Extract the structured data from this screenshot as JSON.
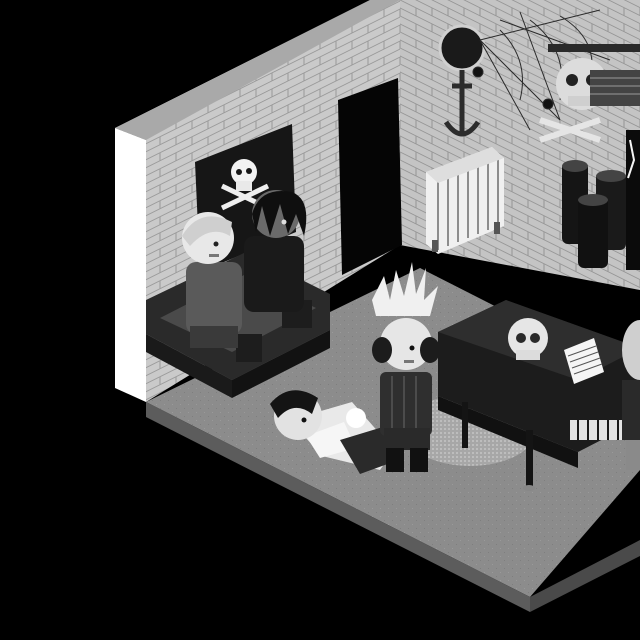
{
  "scene": {
    "style": "isometric pixel-art room, grayscale",
    "palette": {
      "background": "#000000",
      "floor": "#8a8a8a",
      "floor_edge": "#5c5c5c",
      "wall": "#c9c9c9",
      "wall_top": "#a8a8a8",
      "mortar": "#9c9c9c",
      "dark": "#1c1c1c",
      "mid": "#3a3a3a",
      "light": "#e6e6e6",
      "white": "#ffffff"
    },
    "objects": [
      "room-floor",
      "left-brick-wall",
      "right-brick-wall",
      "doorway",
      "pirate-flag",
      "radiator",
      "spider-web",
      "anchor-wall-decor",
      "skull-guitar-decor",
      "black-speaker-tower",
      "sofa",
      "character-sitting-light-hair",
      "character-sitting-dreadlocks",
      "character-standing-spiky-hair",
      "character-lying-down",
      "grand-piano",
      "skull-ornament",
      "sheet-music",
      "round-rug",
      "character-partial-right"
    ]
  }
}
